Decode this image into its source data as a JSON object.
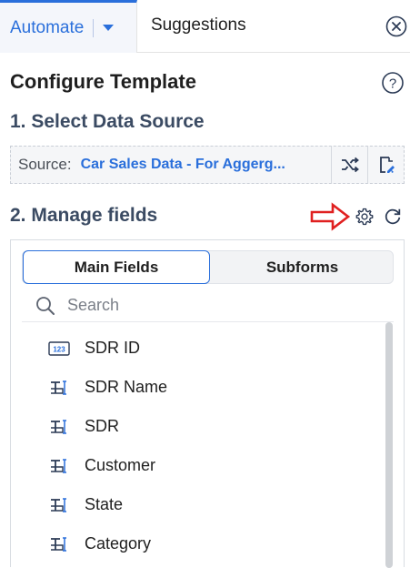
{
  "tabs": {
    "automate": "Automate",
    "suggestions": "Suggestions"
  },
  "panel": {
    "title": "Configure Template",
    "step1": "1. Select Data Source",
    "step2": "2. Manage fields"
  },
  "source": {
    "label": "Source:",
    "value": "Car Sales Data - For Aggerg..."
  },
  "segments": {
    "main": "Main Fields",
    "sub": "Subforms",
    "selected": "Main Fields"
  },
  "search": {
    "placeholder": "Search"
  },
  "fields": [
    {
      "name": "SDR ID",
      "icon": "number-field-icon"
    },
    {
      "name": "SDR Name",
      "icon": "text-field-icon"
    },
    {
      "name": "SDR",
      "icon": "text-field-icon"
    },
    {
      "name": "Customer",
      "icon": "text-field-icon"
    },
    {
      "name": "State",
      "icon": "text-field-icon"
    },
    {
      "name": "Category",
      "icon": "text-field-icon"
    }
  ],
  "colors": {
    "accent": "#2a6fdb",
    "annotation_arrow": "#e02020"
  }
}
